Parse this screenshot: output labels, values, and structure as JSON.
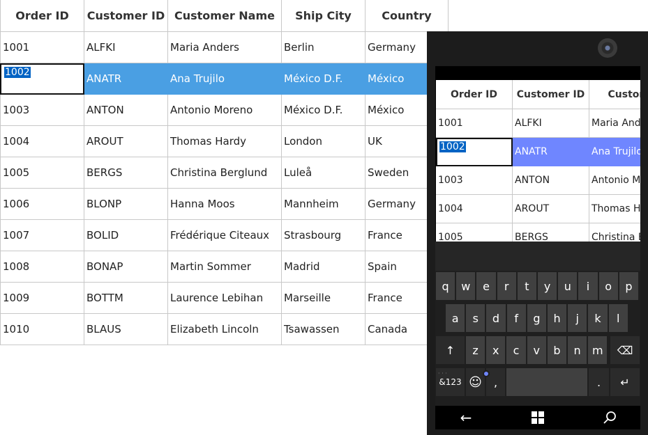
{
  "main_grid": {
    "headers": [
      "Order ID",
      "Customer ID",
      "Customer Name",
      "Ship City",
      "Country"
    ],
    "rows": [
      [
        "1001",
        "ALFKI",
        "Maria Anders",
        "Berlin",
        "Germany"
      ],
      [
        "1002",
        "ANATR",
        "Ana Trujilo",
        "México D.F.",
        "México"
      ],
      [
        "1003",
        "ANTON",
        "Antonio Moreno",
        "México D.F.",
        "México"
      ],
      [
        "1004",
        "AROUT",
        "Thomas Hardy",
        "London",
        "UK"
      ],
      [
        "1005",
        "BERGS",
        "Christina Berglund",
        "Luleå",
        "Sweden"
      ],
      [
        "1006",
        "BLONP",
        "Hanna Moos",
        "Mannheim",
        "Germany"
      ],
      [
        "1007",
        "BOLID",
        "Frédérique Citeaux",
        "Strasbourg",
        "France"
      ],
      [
        "1008",
        "BONAP",
        "Martin Sommer",
        "Madrid",
        "Spain"
      ],
      [
        "1009",
        "BOTTM",
        "Laurence Lebihan",
        "Marseille",
        "France"
      ],
      [
        "1010",
        "BLAUS",
        "Elizabeth Lincoln",
        "Tsawassen",
        "Canada"
      ]
    ],
    "selected_row_index": 1,
    "editing_value": "1002",
    "selection_color": "#4a9fe3"
  },
  "phone_grid": {
    "headers": [
      "Order ID",
      "Customer ID",
      "Customer Name"
    ],
    "rows": [
      [
        "1001",
        "ALFKI",
        "Maria Anders"
      ],
      [
        "1002",
        "ANATR",
        "Ana Trujilo"
      ],
      [
        "1003",
        "ANTON",
        "Antonio Moreno"
      ],
      [
        "1004",
        "AROUT",
        "Thomas Hardy"
      ],
      [
        "1005",
        "BERGS",
        "Christina Berglund"
      ]
    ],
    "selected_row_index": 1,
    "editing_value": "1002",
    "selection_color": "#6f86ff"
  },
  "keyboard": {
    "row1": [
      "q",
      "w",
      "e",
      "r",
      "t",
      "y",
      "u",
      "i",
      "o",
      "p"
    ],
    "row2": [
      "a",
      "s",
      "d",
      "f",
      "g",
      "h",
      "j",
      "k",
      "l"
    ],
    "row3": [
      "z",
      "x",
      "c",
      "v",
      "b",
      "n",
      "m"
    ],
    "shift_label": "↑",
    "backspace_label": "⌫",
    "symbols_label": "&123",
    "emoji_label": "☺",
    "comma_label": ",",
    "period_label": ".",
    "enter_label": "↵",
    "symbols_hint": "· · ·"
  },
  "navbar": {
    "back_label": "←",
    "home_label": "⊞",
    "search_label": "⌕"
  }
}
